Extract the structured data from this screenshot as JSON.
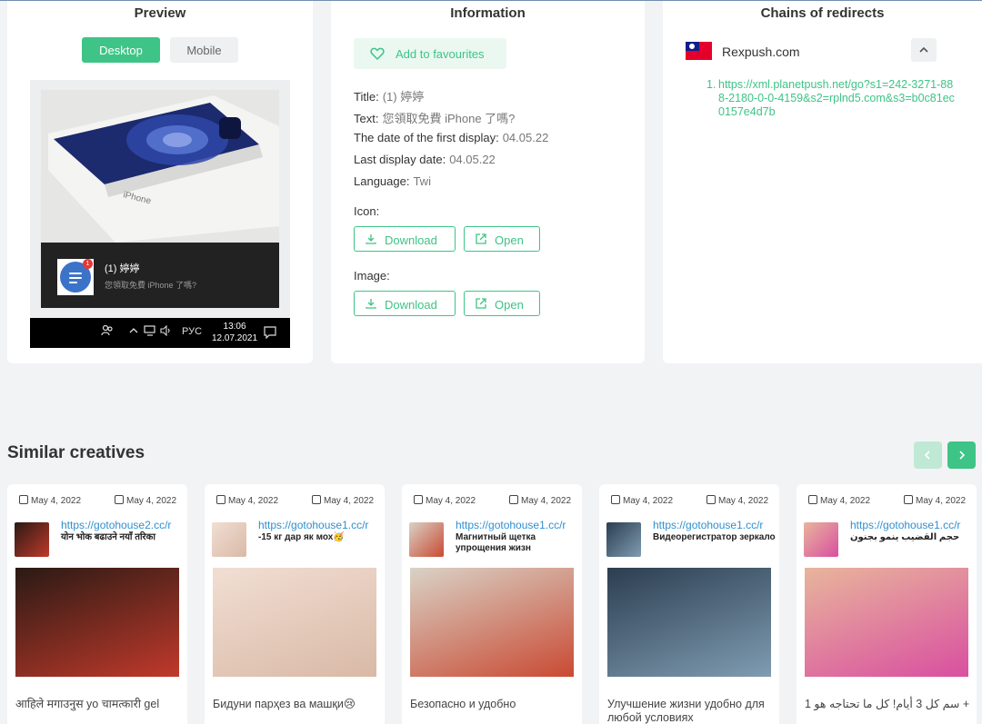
{
  "preview": {
    "title": "Preview",
    "tabs": [
      "Desktop",
      "Mobile"
    ],
    "notification": {
      "title": "(1) 婷婷",
      "text": "您領取免費 iPhone 了嗎?",
      "badge": "1"
    },
    "taskbar": {
      "language": "РУС",
      "time": "13:06",
      "date": "12.07.2021"
    }
  },
  "information": {
    "title": "Information",
    "favourite_label": "Add to favourites",
    "rows": [
      {
        "label": "Title:",
        "value": "(1) 婷婷"
      },
      {
        "label": "Text:",
        "value": "您領取免費 iPhone 了嗎?"
      },
      {
        "label": "The date of the first display:",
        "value": "04.05.22"
      },
      {
        "label": "Last display date:",
        "value": "04.05.22"
      },
      {
        "label": "Language:",
        "value": "Twi"
      }
    ],
    "icon_label": "Icon:",
    "image_label": "Image:",
    "download_label": "Download",
    "open_label": "Open"
  },
  "chains": {
    "title": "Chains of redirects",
    "network": "Rexpush.com",
    "redirects": [
      {
        "index": "1.",
        "url": "https://xml.planetpush.net/go?s1=242-3271-888-2180-0-0-4159&s2=rplnd5.com&s3=b0c81ec0157e4d7b"
      }
    ]
  },
  "similar": {
    "title": "Similar creatives",
    "cards": [
      {
        "date1": "May 4, 2022",
        "date2": "May 4, 2022",
        "url": "https://gotohouse2.cc/r",
        "title": "योन भोक बढाउने नयाँ तरिका",
        "caption": "आहिले मगाउनुस yo चामत्कारी gel",
        "colors": [
          "#2a1a14",
          "#c0392b"
        ]
      },
      {
        "date1": "May 4, 2022",
        "date2": "May 4, 2022",
        "url": "https://gotohouse1.cc/r",
        "title": "-15 кг дар як мох🥳",
        "caption": "Бидуни парҳез ва машқи😢",
        "colors": [
          "#f1ded3",
          "#d9b9a6"
        ]
      },
      {
        "date1": "May 4, 2022",
        "date2": "May 4, 2022",
        "url": "https://gotohouse1.cc/r",
        "title": "Магнитный щетка упрощения жизн",
        "caption": "Безопасно и удобно",
        "colors": [
          "#d9d2c6",
          "#c94a33"
        ]
      },
      {
        "date1": "May 4, 2022",
        "date2": "May 4, 2022",
        "url": "https://gotohouse1.cc/r",
        "title": "Видеорегистратор зеркало",
        "caption": "Улучшение жизни удобно для любой условиях",
        "colors": [
          "#2c3e50",
          "#7f9cb2"
        ]
      },
      {
        "date1": "May 4, 2022",
        "date2": "May 4, 2022",
        "url": "https://gotohouse1.cc/r",
        "title": "حجم القضيب ينمو بجنون",
        "caption": "سم كل 3 أيام! كل ما تحتاجه هو 1 +",
        "colors": [
          "#e8b59c",
          "#d94fa0"
        ]
      }
    ]
  }
}
